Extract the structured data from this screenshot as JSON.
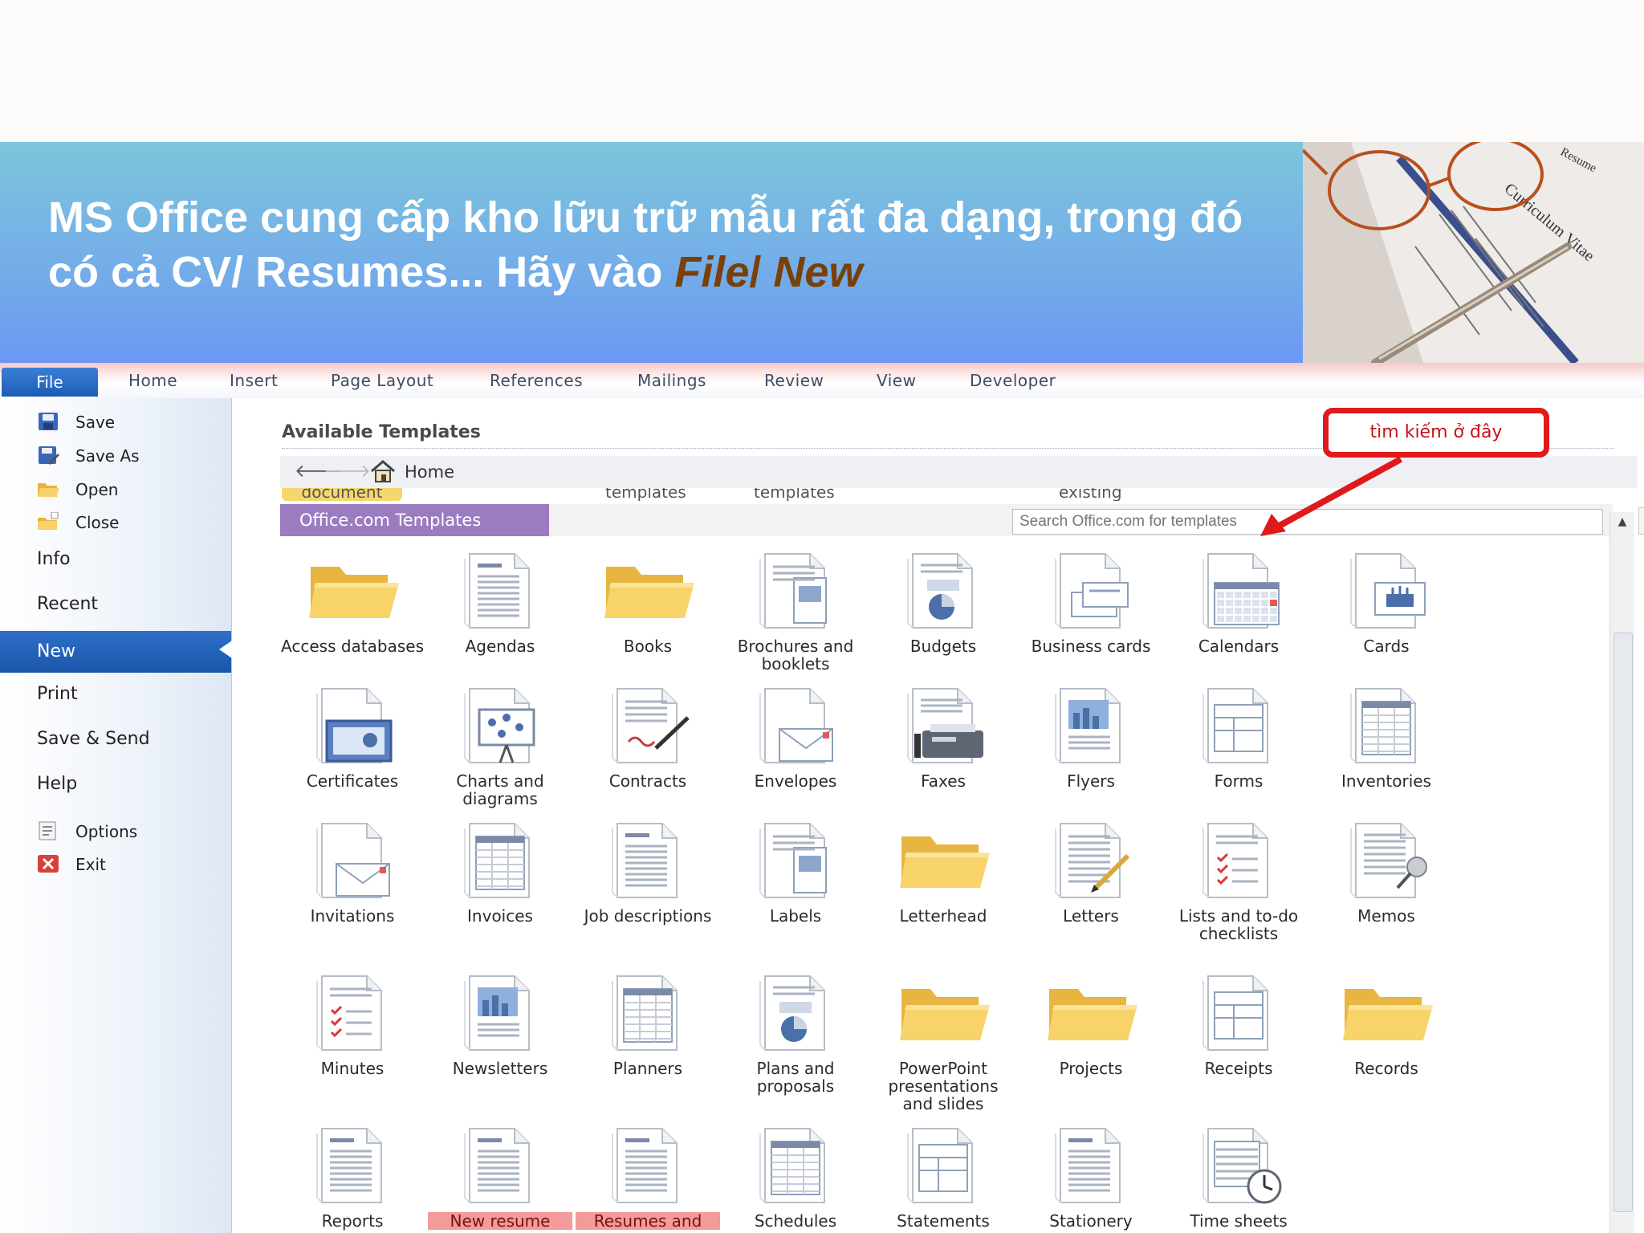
{
  "slide": {
    "title_part1": "MS Office cung cấp kho lữu trữ mẫu rất đa dạng, trong đó có cả CV/ Resumes... Hãy vào ",
    "title_file": "File",
    "title_sep": "/ ",
    "title_new": "New",
    "photo_icon": "resume-glasses-pen-photo"
  },
  "ribbon": {
    "tabs": [
      "File",
      "Home",
      "Insert",
      "Page Layout",
      "References",
      "Mailings",
      "Review",
      "View",
      "Developer"
    ]
  },
  "sidebar": {
    "actions": [
      {
        "label": "Save",
        "icon": "save-icon"
      },
      {
        "label": "Save As",
        "icon": "save-as-icon"
      },
      {
        "label": "Open",
        "icon": "open-folder-icon"
      },
      {
        "label": "Close",
        "icon": "close-folder-icon"
      }
    ],
    "sections": [
      "Info",
      "Recent",
      "New",
      "Print",
      "Save & Send",
      "Help"
    ],
    "bottom": [
      {
        "label": "Options",
        "icon": "options-icon"
      },
      {
        "label": "Exit",
        "icon": "exit-icon"
      }
    ]
  },
  "main": {
    "heading": "Available Templates",
    "nav_home": "Home",
    "partial_labels": [
      "document",
      "templates",
      "templates",
      "existing"
    ],
    "office_tab": "Office.com Templates",
    "search_placeholder": "Search Office.com for templates",
    "go_symbol": "➜"
  },
  "callout": {
    "text": "tìm kiếm ở đây",
    "color": "#e0191b"
  },
  "templates": [
    {
      "label": "Access databases",
      "icon": "folder"
    },
    {
      "label": "Agendas",
      "icon": "doc"
    },
    {
      "label": "Books",
      "icon": "folder"
    },
    {
      "label": "Brochures and booklets",
      "icon": "doc-stack"
    },
    {
      "label": "Budgets",
      "icon": "doc-chart"
    },
    {
      "label": "Business cards",
      "icon": "doc-cards"
    },
    {
      "label": "Calendars",
      "icon": "doc-calendar"
    },
    {
      "label": "Cards",
      "icon": "doc-cake"
    },
    {
      "label": "Certificates",
      "icon": "doc-certificate"
    },
    {
      "label": "Charts and diagrams",
      "icon": "doc-easel"
    },
    {
      "label": "Contracts",
      "icon": "doc-pen"
    },
    {
      "label": "Envelopes",
      "icon": "doc-envelope"
    },
    {
      "label": "Faxes",
      "icon": "doc-fax"
    },
    {
      "label": "Flyers",
      "icon": "doc-flyer"
    },
    {
      "label": "Forms",
      "icon": "doc-form"
    },
    {
      "label": "Inventories",
      "icon": "doc-table"
    },
    {
      "label": "Invitations",
      "icon": "doc-envelope"
    },
    {
      "label": "Invoices",
      "icon": "doc-table"
    },
    {
      "label": "Job descriptions",
      "icon": "doc"
    },
    {
      "label": "Labels",
      "icon": "doc-stack"
    },
    {
      "label": "Letterhead",
      "icon": "folder"
    },
    {
      "label": "Letters",
      "icon": "doc-pencil"
    },
    {
      "label": "Lists and to-do checklists",
      "icon": "doc-checklist"
    },
    {
      "label": "Memos",
      "icon": "doc-pin"
    },
    {
      "label": "Minutes",
      "icon": "doc-checklist"
    },
    {
      "label": "Newsletters",
      "icon": "doc-flyer"
    },
    {
      "label": "Planners",
      "icon": "doc-table"
    },
    {
      "label": "Plans and proposals",
      "icon": "doc-chart"
    },
    {
      "label": "PowerPoint presentations and slides",
      "icon": "folder"
    },
    {
      "label": "Projects",
      "icon": "folder"
    },
    {
      "label": "Receipts",
      "icon": "doc-form"
    },
    {
      "label": "Records",
      "icon": "folder"
    },
    {
      "label": "Reports",
      "icon": "doc"
    },
    {
      "label": "New resume",
      "icon": "doc",
      "highlight": true
    },
    {
      "label": "Resumes and",
      "icon": "doc",
      "highlight": true
    },
    {
      "label": "Schedules",
      "icon": "doc-table"
    },
    {
      "label": "Statements",
      "icon": "doc-form"
    },
    {
      "label": "Stationery",
      "icon": "doc"
    },
    {
      "label": "Time sheets",
      "icon": "doc-clock"
    }
  ]
}
